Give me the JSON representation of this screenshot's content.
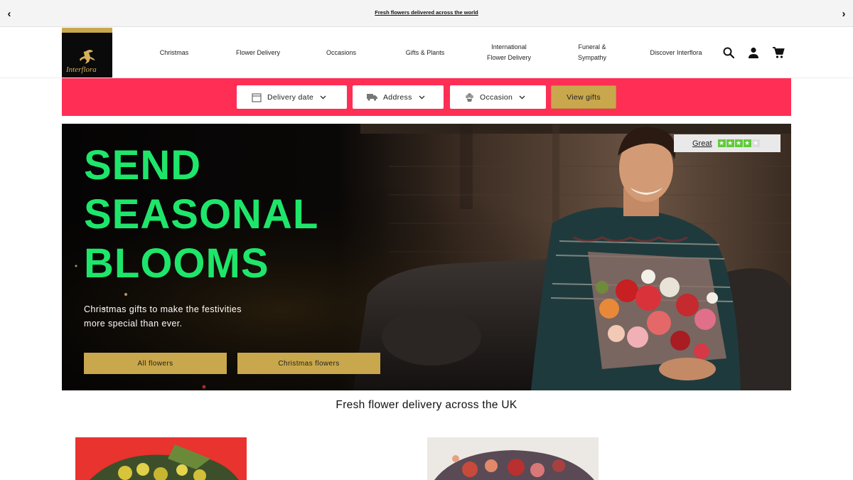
{
  "promo": {
    "message": "Fresh flowers delivered across the world",
    "prev_icon": "chevron-left-icon",
    "next_icon": "chevron-right-icon"
  },
  "header": {
    "logo_text": "Interflora",
    "nav": [
      {
        "label": "Christmas"
      },
      {
        "label": "Flower Delivery"
      },
      {
        "label": "Occasions"
      },
      {
        "label": "Gifts & Plants"
      },
      {
        "label_line1": "International",
        "label_line2": "Flower Delivery"
      },
      {
        "label_line1": "Funeral &",
        "label_line2": "Sympathy"
      },
      {
        "label": "Discover Interflora"
      }
    ],
    "icons": [
      "search-icon",
      "account-icon",
      "cart-icon"
    ]
  },
  "finder": {
    "delivery_date": "Delivery date",
    "address": "Address",
    "occasion": "Occasion",
    "view_gifts": "View gifts"
  },
  "hero": {
    "headline_line1": "SEND",
    "headline_line2": "SEASONAL",
    "headline_line3": "BLOOMS",
    "subtext_line1": "Christmas gifts to make the festivities",
    "subtext_line2": "more special than ever.",
    "cta_primary": "All flowers",
    "cta_secondary": "Christmas flowers",
    "trustpilot_label": "Great",
    "trustpilot_stars": 4
  },
  "section": {
    "title": "Fresh flower delivery across the UK"
  },
  "colors": {
    "finder_bg": "#ff2e55",
    "gold": "#c9a74c",
    "headline_green": "#1ee66a",
    "trust_green": "#5fcb3a"
  }
}
